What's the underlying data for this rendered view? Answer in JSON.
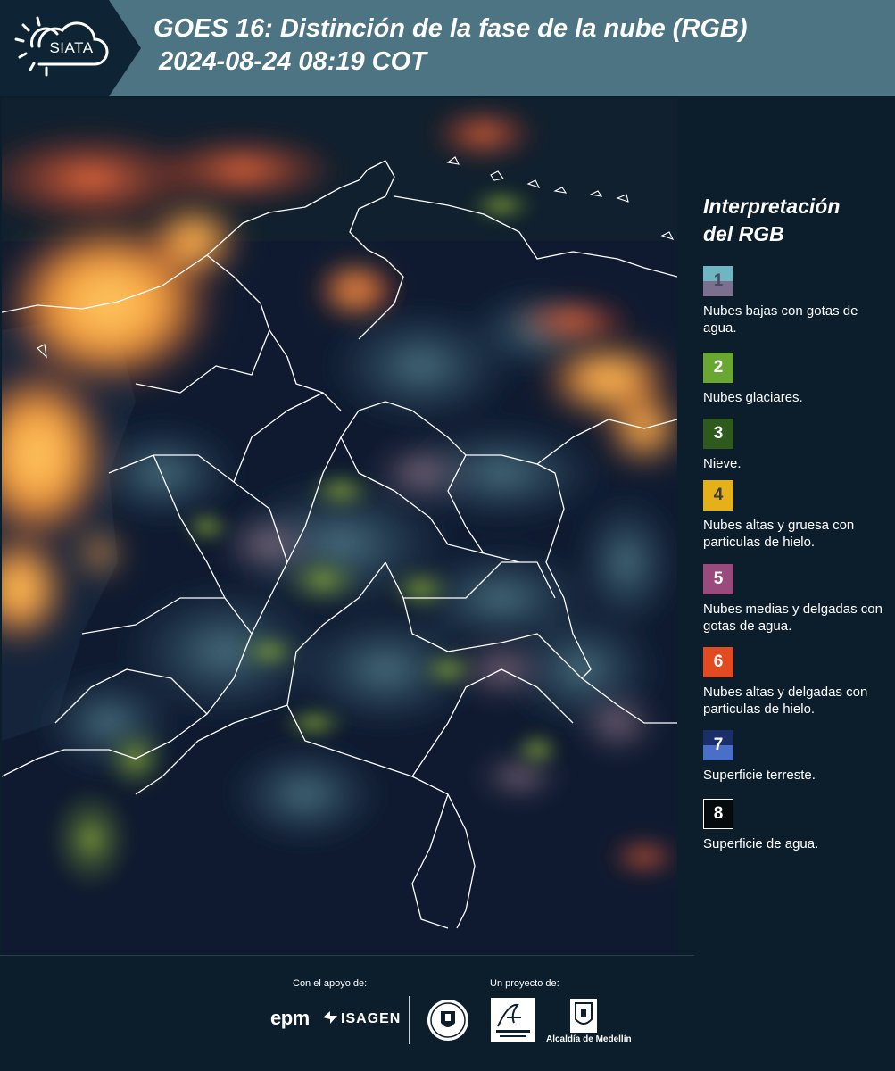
{
  "header": {
    "logo_text": "SIATA",
    "title_line1": "GOES 16: Distinción de la fase de la nube (RGB)",
    "title_line2": "2024-08-24 08:19 COT"
  },
  "legend": {
    "title_line1": "Interpretación",
    "title_line2": "del RGB",
    "items": [
      {
        "number": "1",
        "label": "Nubes bajas con gotas de agua.",
        "color_top": "#6fb6c3",
        "color_bottom": "#7b708d",
        "text_color": "#4a4a60"
      },
      {
        "number": "2",
        "label": "Nubes glaciares.",
        "color_top": "#6aa632",
        "color_bottom": "#6aa632",
        "text_color": "#ffffff"
      },
      {
        "number": "3",
        "label": "Nieve.",
        "color_top": "#2f5a1e",
        "color_bottom": "#2f5a1e",
        "text_color": "#ffffff"
      },
      {
        "number": "4",
        "label": "Nubes altas y gruesa con particulas de hielo.",
        "color_top": "#e5b11a",
        "color_bottom": "#e5b11a",
        "text_color": "#3a3a3a"
      },
      {
        "number": "5",
        "label": "Nubes medias y delgadas con gotas de agua.",
        "color_top": "#9a4b7e",
        "color_bottom": "#9a4b7e",
        "text_color": "#ffffff"
      },
      {
        "number": "6",
        "label": "Nubes altas y delgadas con particulas de hielo.",
        "color_top": "#e24b22",
        "color_bottom": "#e24b22",
        "text_color": "#ffffff"
      },
      {
        "number": "7",
        "label": "Superficie terreste.",
        "color_top": "#1a2f6a",
        "color_bottom": "#4a6fc9",
        "text_color": "#ffffff"
      },
      {
        "number": "8",
        "label": "Superficie de agua.",
        "color_top": "#050a0c",
        "color_bottom": "#050a0c",
        "text_color": "#ffffff"
      }
    ]
  },
  "footer": {
    "support_label": "Con el apoyo de:",
    "project_label": "Un proyecto de:",
    "epm_text": "epm",
    "isagen_text": "ISAGEN",
    "alcaldia_text": "Alcaldía de Medellín"
  }
}
